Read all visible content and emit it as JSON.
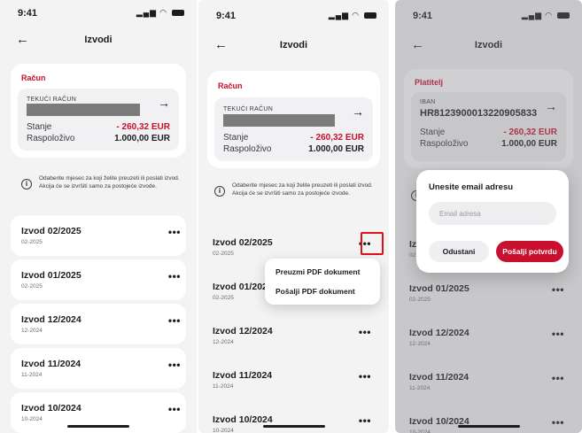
{
  "status": {
    "time": "9:41"
  },
  "header": {
    "title": "Izvodi"
  },
  "account": {
    "section_label": "Račun",
    "payer_label": "Platitelj",
    "type_label": "TEKUĆI RAČUN",
    "iban_label": "IBAN",
    "iban_value": "HR8123900013220905833",
    "balance_label": "Stanje",
    "balance_value": "- 260,32 EUR",
    "available_label": "Raspoloživo",
    "available_value": "1.000,00 EUR"
  },
  "info_text": "Odaberite mjesec za koji želite preuzeti ili poslati izvod. Akcija će se izvršiti samo za postojeće izvode.",
  "statements": [
    {
      "title": "Izvod 02/2025",
      "sub": "02-2025"
    },
    {
      "title": "Izvod 01/2025",
      "sub": "02-2025"
    },
    {
      "title": "Izvod 12/2024",
      "sub": "12-2024"
    },
    {
      "title": "Izvod 11/2024",
      "sub": "11-2024"
    },
    {
      "title": "Izvod 10/2024",
      "sub": "10-2024"
    }
  ],
  "p2_statements": [
    {
      "title": "Izvod 02/2025",
      "sub": "02-2025"
    },
    {
      "title": "Izvod 01/202",
      "sub": "02-2025"
    },
    {
      "title": "Izvod 12/2024",
      "sub": "12-2024"
    },
    {
      "title": "Izvod 11/2024",
      "sub": "11-2024"
    },
    {
      "title": "Izvod 10/2024",
      "sub": "10-2024"
    }
  ],
  "p3_statements": [
    {
      "title": "Iz",
      "sub": "02"
    },
    {
      "title": "Izvod 01/2025",
      "sub": "02-2025"
    },
    {
      "title": "Izvod 12/2024",
      "sub": "12-2024"
    },
    {
      "title": "Izvod 11/2024",
      "sub": "11-2024"
    },
    {
      "title": "Izvod 10/2024",
      "sub": "10-2024"
    }
  ],
  "menu": {
    "download": "Preuzmi PDF dokument",
    "send": "Pošalji PDF dokument"
  },
  "dialog": {
    "title": "Unesite email adresu",
    "placeholder": "Email adresa",
    "cancel": "Odustani",
    "confirm": "Pošalji potvrdu"
  },
  "icons": {
    "back": "arrow-left-icon",
    "forward": "arrow-right-icon",
    "info": "info-icon",
    "more": "more-dots-icon"
  },
  "colors": {
    "accent": "#c8102e",
    "highlight": "#e0101d"
  }
}
